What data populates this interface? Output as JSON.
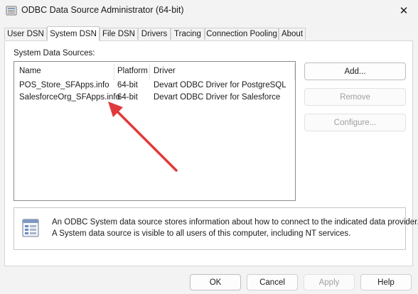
{
  "window": {
    "title": "ODBC Data Source Administrator (64-bit)",
    "icon": "odbc-app-icon",
    "close_glyph": "✕"
  },
  "tabs": [
    {
      "label": "User DSN",
      "active": false
    },
    {
      "label": "System DSN",
      "active": true
    },
    {
      "label": "File DSN",
      "active": false
    },
    {
      "label": "Drivers",
      "active": false
    },
    {
      "label": "Tracing",
      "active": false
    },
    {
      "label": "Connection Pooling",
      "active": false
    },
    {
      "label": "About",
      "active": false
    }
  ],
  "system_dsn": {
    "group_label": "System Data Sources:",
    "columns": [
      "Name",
      "Platform",
      "Driver"
    ],
    "rows": [
      {
        "name": "POS_Store_SFApps.info",
        "platform": "64-bit",
        "driver": "Devart ODBC Driver for PostgreSQL"
      },
      {
        "name": "SalesforceOrg_SFApps.info",
        "platform": "64-bit",
        "driver": "Devart ODBC Driver for Salesforce"
      }
    ],
    "buttons": {
      "add": "Add...",
      "remove": "Remove",
      "configure": "Configure..."
    },
    "info": {
      "icon": "data-sources-icon",
      "line1": "An ODBC System data source stores information about how to connect to the indicated data provider.",
      "line2": "A System data source is visible to all users of this computer, including NT services."
    }
  },
  "footer": {
    "ok": "OK",
    "cancel": "Cancel",
    "apply": "Apply",
    "help": "Help"
  },
  "annotation": {
    "color": "#e0393b"
  }
}
